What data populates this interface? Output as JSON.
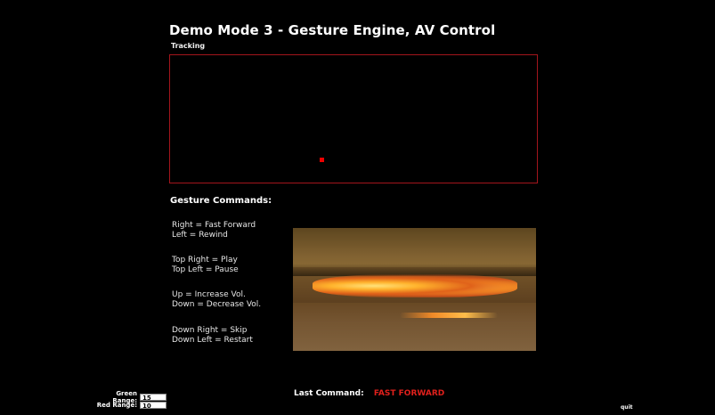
{
  "page": {
    "title": "Demo Mode 3 - Gesture Engine, AV Control",
    "tracking_label": "Tracking"
  },
  "gesture_commands": {
    "title": "Gesture Commands:",
    "groups": [
      {
        "line1": "Right = Fast Forward",
        "line2": "Left = Rewind"
      },
      {
        "line1": "Top Right = Play",
        "line2": "Top Left = Pause"
      },
      {
        "line1": "Up = Increase Vol.",
        "line2": "Down = Decrease Vol."
      },
      {
        "line1": "Down Right = Skip",
        "line2": "Down Left = Restart"
      }
    ]
  },
  "ranges": {
    "green_label": "Green Range:",
    "green_value": "15",
    "red_label": "Red Range:",
    "red_value": "10"
  },
  "status": {
    "last_command_label": "Last Command:",
    "last_command_value": "FAST FORWARD"
  },
  "footer": {
    "quit_label": "quit"
  },
  "colors": {
    "background": "#000000",
    "tracking_border": "#a3151c",
    "tracking_dot": "#ee0000",
    "last_command_value": "#e0201c"
  }
}
